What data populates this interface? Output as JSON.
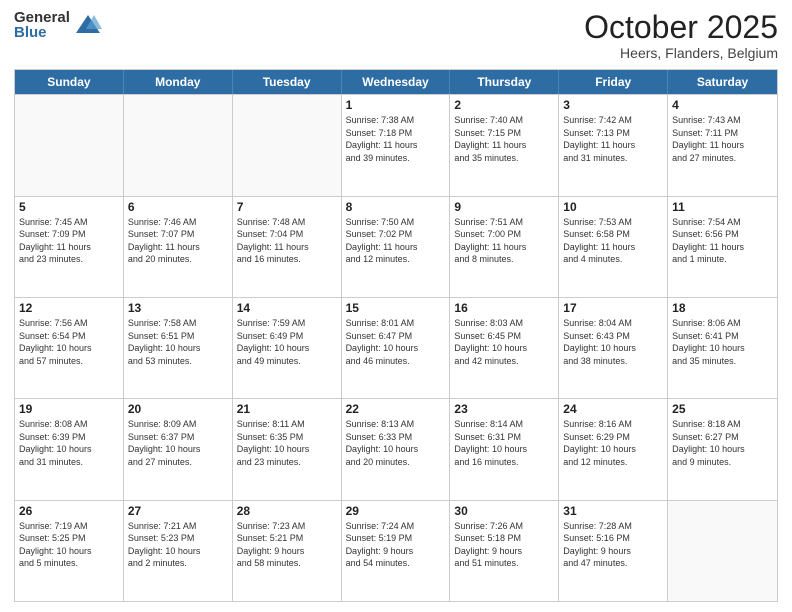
{
  "logo": {
    "general": "General",
    "blue": "Blue"
  },
  "title": "October 2025",
  "location": "Heers, Flanders, Belgium",
  "header_days": [
    "Sunday",
    "Monday",
    "Tuesday",
    "Wednesday",
    "Thursday",
    "Friday",
    "Saturday"
  ],
  "weeks": [
    [
      {
        "day": "",
        "info": ""
      },
      {
        "day": "",
        "info": ""
      },
      {
        "day": "",
        "info": ""
      },
      {
        "day": "1",
        "info": "Sunrise: 7:38 AM\nSunset: 7:18 PM\nDaylight: 11 hours\nand 39 minutes."
      },
      {
        "day": "2",
        "info": "Sunrise: 7:40 AM\nSunset: 7:15 PM\nDaylight: 11 hours\nand 35 minutes."
      },
      {
        "day": "3",
        "info": "Sunrise: 7:42 AM\nSunset: 7:13 PM\nDaylight: 11 hours\nand 31 minutes."
      },
      {
        "day": "4",
        "info": "Sunrise: 7:43 AM\nSunset: 7:11 PM\nDaylight: 11 hours\nand 27 minutes."
      }
    ],
    [
      {
        "day": "5",
        "info": "Sunrise: 7:45 AM\nSunset: 7:09 PM\nDaylight: 11 hours\nand 23 minutes."
      },
      {
        "day": "6",
        "info": "Sunrise: 7:46 AM\nSunset: 7:07 PM\nDaylight: 11 hours\nand 20 minutes."
      },
      {
        "day": "7",
        "info": "Sunrise: 7:48 AM\nSunset: 7:04 PM\nDaylight: 11 hours\nand 16 minutes."
      },
      {
        "day": "8",
        "info": "Sunrise: 7:50 AM\nSunset: 7:02 PM\nDaylight: 11 hours\nand 12 minutes."
      },
      {
        "day": "9",
        "info": "Sunrise: 7:51 AM\nSunset: 7:00 PM\nDaylight: 11 hours\nand 8 minutes."
      },
      {
        "day": "10",
        "info": "Sunrise: 7:53 AM\nSunset: 6:58 PM\nDaylight: 11 hours\nand 4 minutes."
      },
      {
        "day": "11",
        "info": "Sunrise: 7:54 AM\nSunset: 6:56 PM\nDaylight: 11 hours\nand 1 minute."
      }
    ],
    [
      {
        "day": "12",
        "info": "Sunrise: 7:56 AM\nSunset: 6:54 PM\nDaylight: 10 hours\nand 57 minutes."
      },
      {
        "day": "13",
        "info": "Sunrise: 7:58 AM\nSunset: 6:51 PM\nDaylight: 10 hours\nand 53 minutes."
      },
      {
        "day": "14",
        "info": "Sunrise: 7:59 AM\nSunset: 6:49 PM\nDaylight: 10 hours\nand 49 minutes."
      },
      {
        "day": "15",
        "info": "Sunrise: 8:01 AM\nSunset: 6:47 PM\nDaylight: 10 hours\nand 46 minutes."
      },
      {
        "day": "16",
        "info": "Sunrise: 8:03 AM\nSunset: 6:45 PM\nDaylight: 10 hours\nand 42 minutes."
      },
      {
        "day": "17",
        "info": "Sunrise: 8:04 AM\nSunset: 6:43 PM\nDaylight: 10 hours\nand 38 minutes."
      },
      {
        "day": "18",
        "info": "Sunrise: 8:06 AM\nSunset: 6:41 PM\nDaylight: 10 hours\nand 35 minutes."
      }
    ],
    [
      {
        "day": "19",
        "info": "Sunrise: 8:08 AM\nSunset: 6:39 PM\nDaylight: 10 hours\nand 31 minutes."
      },
      {
        "day": "20",
        "info": "Sunrise: 8:09 AM\nSunset: 6:37 PM\nDaylight: 10 hours\nand 27 minutes."
      },
      {
        "day": "21",
        "info": "Sunrise: 8:11 AM\nSunset: 6:35 PM\nDaylight: 10 hours\nand 23 minutes."
      },
      {
        "day": "22",
        "info": "Sunrise: 8:13 AM\nSunset: 6:33 PM\nDaylight: 10 hours\nand 20 minutes."
      },
      {
        "day": "23",
        "info": "Sunrise: 8:14 AM\nSunset: 6:31 PM\nDaylight: 10 hours\nand 16 minutes."
      },
      {
        "day": "24",
        "info": "Sunrise: 8:16 AM\nSunset: 6:29 PM\nDaylight: 10 hours\nand 12 minutes."
      },
      {
        "day": "25",
        "info": "Sunrise: 8:18 AM\nSunset: 6:27 PM\nDaylight: 10 hours\nand 9 minutes."
      }
    ],
    [
      {
        "day": "26",
        "info": "Sunrise: 7:19 AM\nSunset: 5:25 PM\nDaylight: 10 hours\nand 5 minutes."
      },
      {
        "day": "27",
        "info": "Sunrise: 7:21 AM\nSunset: 5:23 PM\nDaylight: 10 hours\nand 2 minutes."
      },
      {
        "day": "28",
        "info": "Sunrise: 7:23 AM\nSunset: 5:21 PM\nDaylight: 9 hours\nand 58 minutes."
      },
      {
        "day": "29",
        "info": "Sunrise: 7:24 AM\nSunset: 5:19 PM\nDaylight: 9 hours\nand 54 minutes."
      },
      {
        "day": "30",
        "info": "Sunrise: 7:26 AM\nSunset: 5:18 PM\nDaylight: 9 hours\nand 51 minutes."
      },
      {
        "day": "31",
        "info": "Sunrise: 7:28 AM\nSunset: 5:16 PM\nDaylight: 9 hours\nand 47 minutes."
      },
      {
        "day": "",
        "info": ""
      }
    ]
  ]
}
